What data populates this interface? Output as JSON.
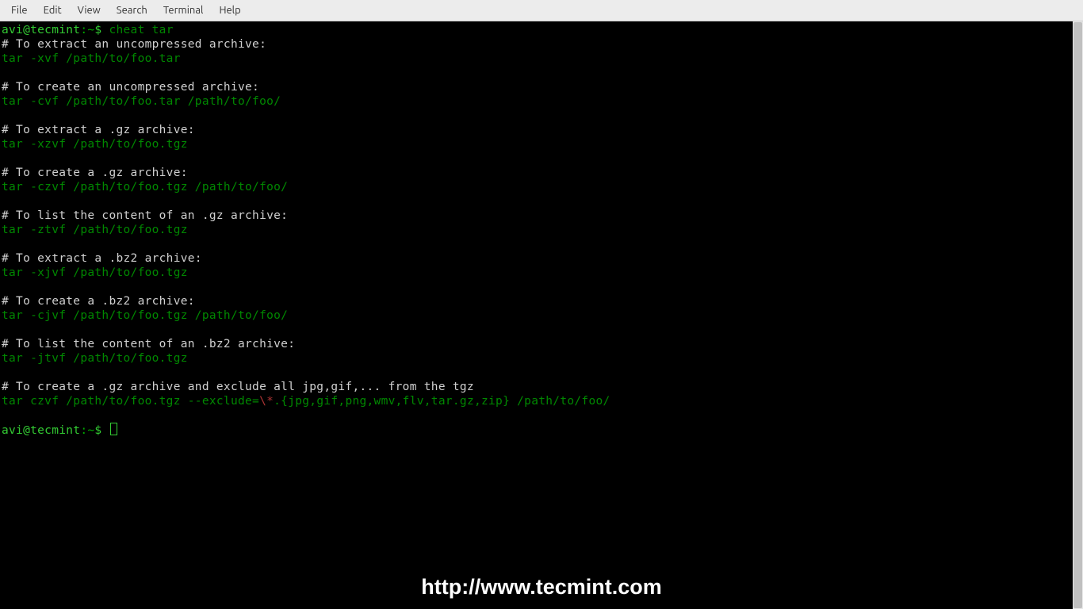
{
  "menubar": {
    "items": [
      "File",
      "Edit",
      "View",
      "Search",
      "Terminal",
      "Help"
    ]
  },
  "terminal": {
    "prompt": {
      "user_host": "avi@tecmint",
      "path": ":~",
      "symbol": "$ "
    },
    "command": "cheat tar",
    "output": [
      {
        "type": "comment",
        "text": "# To extract an uncompressed archive:"
      },
      {
        "type": "cmd",
        "text": "tar -xvf /path/to/foo.tar"
      },
      {
        "type": "blank"
      },
      {
        "type": "comment",
        "text": "# To create an uncompressed archive:"
      },
      {
        "type": "cmd",
        "text": "tar -cvf /path/to/foo.tar /path/to/foo/"
      },
      {
        "type": "blank"
      },
      {
        "type": "comment",
        "text": "# To extract a .gz archive:"
      },
      {
        "type": "cmd",
        "text": "tar -xzvf /path/to/foo.tgz"
      },
      {
        "type": "blank"
      },
      {
        "type": "comment",
        "text": "# To create a .gz archive:"
      },
      {
        "type": "cmd",
        "text": "tar -czvf /path/to/foo.tgz /path/to/foo/"
      },
      {
        "type": "blank"
      },
      {
        "type": "comment",
        "text": "# To list the content of an .gz archive:"
      },
      {
        "type": "cmd",
        "text": "tar -ztvf /path/to/foo.tgz"
      },
      {
        "type": "blank"
      },
      {
        "type": "comment",
        "text": "# To extract a .bz2 archive:"
      },
      {
        "type": "cmd",
        "text": "tar -xjvf /path/to/foo.tgz"
      },
      {
        "type": "blank"
      },
      {
        "type": "comment",
        "text": "# To create a .bz2 archive:"
      },
      {
        "type": "cmd",
        "text": "tar -cjvf /path/to/foo.tgz /path/to/foo/"
      },
      {
        "type": "blank"
      },
      {
        "type": "comment",
        "text": "# To list the content of an .bz2 archive:"
      },
      {
        "type": "cmd",
        "text": "tar -jtvf /path/to/foo.tgz"
      },
      {
        "type": "blank"
      },
      {
        "type": "comment",
        "text": "# To create a .gz archive and exclude all jpg,gif,... from the tgz"
      },
      {
        "type": "cmd_excl",
        "pre": "tar czvf /path/to/foo.tgz --exclude=",
        "esc": "\\*",
        "post": ".{jpg,gif,png,wmv,flv,tar.gz,zip} /path/to/foo/"
      }
    ]
  },
  "watermark": "http://www.tecmint.com"
}
